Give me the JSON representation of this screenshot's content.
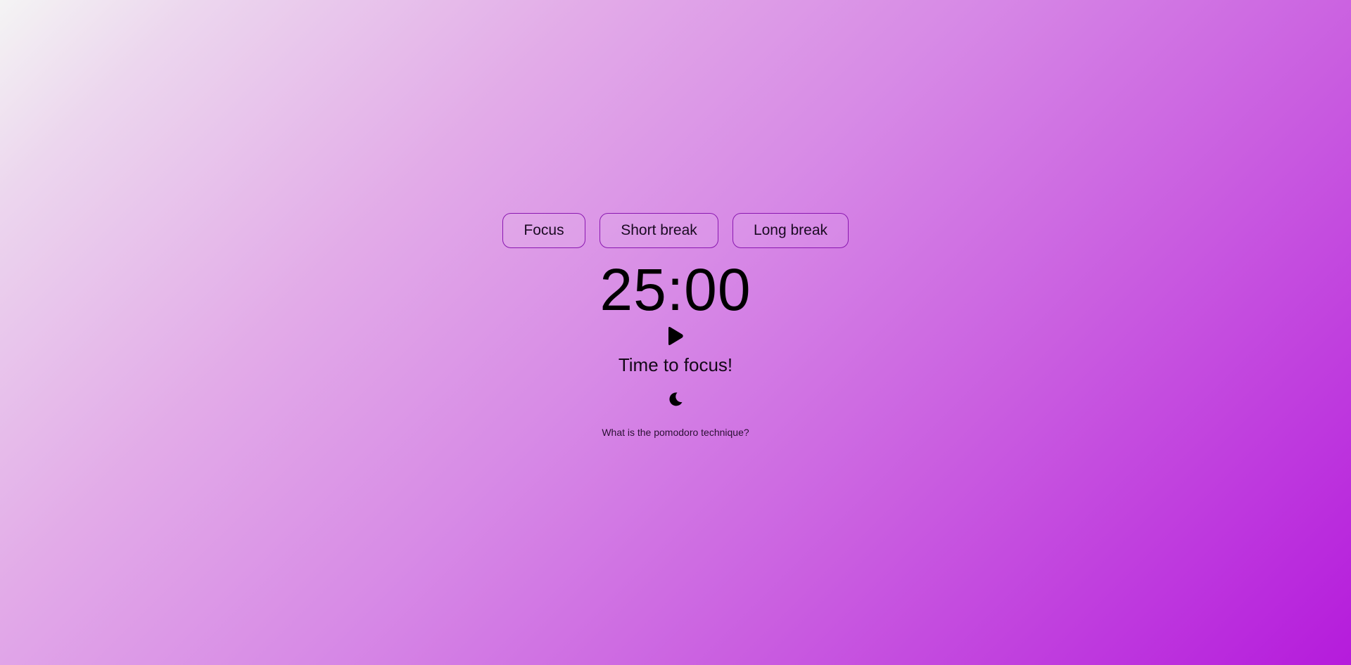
{
  "modes": {
    "focus_label": "Focus",
    "short_break_label": "Short break",
    "long_break_label": "Long break",
    "active": "Focus"
  },
  "timer": {
    "display": "25:00"
  },
  "controls": {
    "play_icon": "play-icon",
    "theme_icon": "moon-icon"
  },
  "status": {
    "message": "Time to focus!"
  },
  "footer": {
    "info_link": "What is the pomodoro technique?"
  },
  "colors": {
    "accent_border": "#8a18b0",
    "gradient_start": "#f4f4f4",
    "gradient_end": "#b51bdc"
  }
}
